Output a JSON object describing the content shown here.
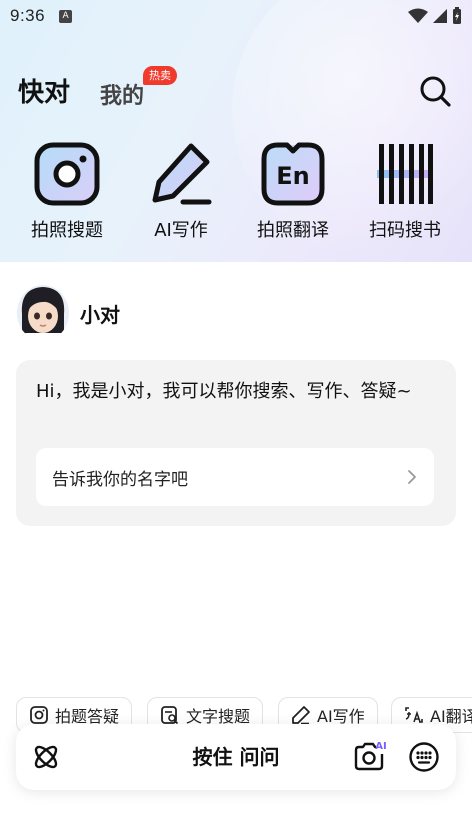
{
  "status": {
    "time": "9:36",
    "a_icon": "A"
  },
  "nav": {
    "tab_active": "快对",
    "tab_mine": "我的",
    "hot_badge": "热卖"
  },
  "tools": [
    {
      "label": "拍照搜题",
      "icon": "camera-lens-icon"
    },
    {
      "label": "AI写作",
      "icon": "pencil-icon"
    },
    {
      "label": "拍照翻译",
      "icon": "en-translate-icon"
    },
    {
      "label": "扫码搜书",
      "icon": "barcode-icon"
    }
  ],
  "assistant": {
    "name": "小对"
  },
  "message": {
    "text": "Hi，我是小对，我可以帮你搜索、写作、答疑~",
    "option": "告诉我你的名字吧"
  },
  "chips": [
    {
      "label": "拍题答疑",
      "icon": "camera-icon"
    },
    {
      "label": "文字搜题",
      "icon": "text-search-icon"
    },
    {
      "label": "AI写作",
      "icon": "pencil-icon"
    },
    {
      "label": "AI翻译",
      "icon": "translate-icon"
    }
  ],
  "input_bar": {
    "hold_label": "按住 问问",
    "ai_badge": "AI"
  },
  "colors": {
    "hot": "#f03a2c",
    "accent_purple": "#7a5cff",
    "accent_blue": "#5ab4f0"
  }
}
